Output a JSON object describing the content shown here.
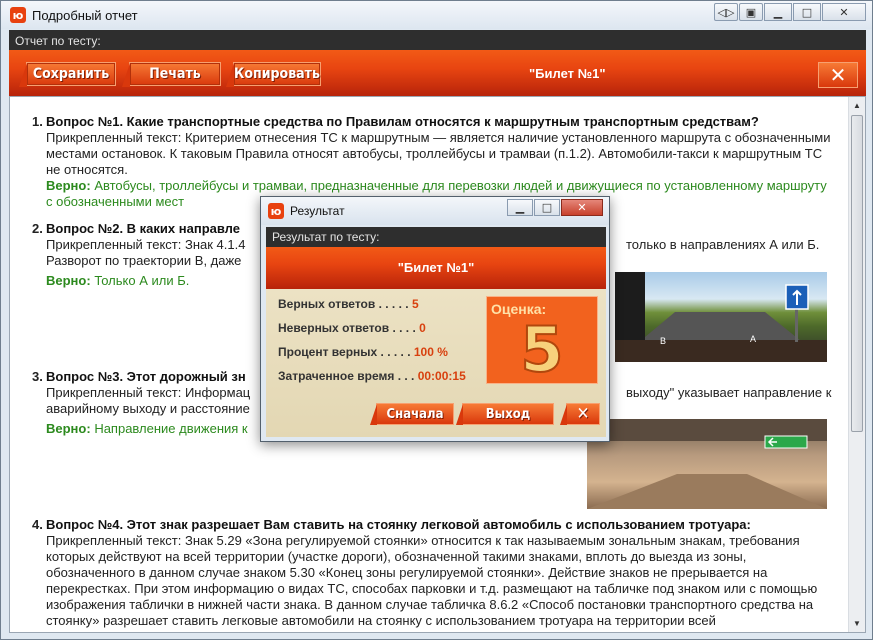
{
  "window": {
    "title": "Подробный отчет",
    "subheader": "Отчет по тесту:",
    "controls": [
      "restore-icon",
      "copy-icon",
      "minimize-icon",
      "maximize-icon",
      "close-icon"
    ]
  },
  "toolbar": {
    "save_label": "Сохранить",
    "print_label": "Печать",
    "copy_label": "Копировать",
    "ticket_title": "\"Билет №1\"",
    "close_label": "✕"
  },
  "questions": [
    {
      "num": "1.",
      "title": "Вопрос №1. Какие транспортные средства по Правилам относятся к маршрутным транспортным средствам?",
      "text": "Прикрепленный текст: Критерием отнесения ТС к маршрутным — является наличие установленного маршрута с обозначенными местами остановок. К таковым Правила относят автобусы, троллейбусы и трамваи (п.1.2). Автомобили-такси к маршрутным ТС не относятся.",
      "correct_label": "Верно:",
      "correct": "Автобусы, троллейбусы и трамваи, предназначенные для перевозки людей и движущиеся по установленному маршруту с обозначенными мест"
    },
    {
      "num": "2.",
      "title": "Вопрос №2. В каких направле",
      "text_a": "Прикрепленный текст: Знак 4.1.4",
      "text_b": "только в направлениях А или Б.",
      "text_c": "Разворот по траектории В, даже",
      "correct_label": "Верно:",
      "correct": "Только А или Б."
    },
    {
      "num": "3.",
      "title": "Вопрос №3. Этот дорожный зн",
      "text_a": "Прикрепленный текст: Информац",
      "text_b": "выходу\" указывает направление к",
      "text_c": "аварийному выходу и расстояние",
      "correct_label": "Верно:",
      "correct": "Направление движения к"
    },
    {
      "num": "4.",
      "title": "Вопрос №4. Этот знак разрешает Вам ставить на стоянку легковой автомобиль с использованием тротуара:",
      "text": "Прикрепленный текст: Знак 5.29 «Зона регулируемой стоянки» относится к так называемым зональным знакам, требования которых действуют на всей территории (участке дороги), обозначенной такими знаками, вплоть до выезда из зоны, обозначенного в данном случае знаком 5.30 «Конец зоны регулируемой стоянки». Действие знаков не прерывается на перекрестках. При этом информацию о видах ТС, способах парковки и т.д. размещают на табличке под знаком или с помощью изображения таблички в нижней части знака. В данном случае табличка 8.6.2 «Способ постановки транспортного средства на стоянку» разрешает ставить легковые автомобили на стоянку с использованием тротуара на территории всей"
    }
  ],
  "dialog": {
    "title": "Результат",
    "subheader": "Результат по тесту:",
    "ticket": "\"Билет №1\"",
    "stats": [
      {
        "label": "Верных ответов",
        "dots": " . . . . . ",
        "value": "5"
      },
      {
        "label": "Неверных ответов",
        "dots": " . . . . ",
        "value": "0"
      },
      {
        "label": "Процент верных",
        "dots": " . . . . . ",
        "value": "100 %"
      },
      {
        "label": "Затраченное время",
        "dots": " . . . ",
        "value": "00:00:15"
      }
    ],
    "grade_label": "Оценка:",
    "grade_value": "5",
    "start_label": "Сначала",
    "exit_label": "Выход",
    "close_label": "✕"
  },
  "colors": {
    "accent": "#e84511",
    "correct_text": "#2c8a1e",
    "value_text": "#d8410f"
  }
}
